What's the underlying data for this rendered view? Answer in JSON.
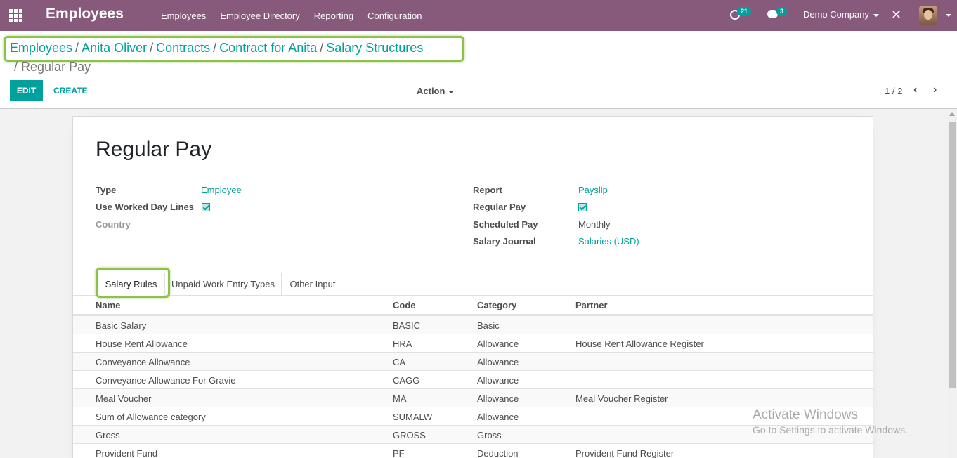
{
  "navbar": {
    "brand": "Employees",
    "menu": [
      "Employees",
      "Employee Directory",
      "Reporting",
      "Configuration"
    ],
    "activity_count": "21",
    "message_count": "3",
    "company": "Demo Company"
  },
  "breadcrumb": {
    "items": [
      "Employees",
      "Anita Oliver",
      "Contracts",
      "Contract for Anita",
      "Salary Structures"
    ],
    "current": "Regular Pay",
    "separator": "/"
  },
  "toolbar": {
    "edit_label": "EDIT",
    "create_label": "CREATE",
    "action_label": "Action",
    "pager": "1 / 2"
  },
  "form": {
    "title": "Regular Pay",
    "left": {
      "type_label": "Type",
      "type_value": "Employee",
      "worked_day_label": "Use Worked Day Lines",
      "worked_day_checked": true,
      "country_label": "Country"
    },
    "right": {
      "report_label": "Report",
      "report_value": "Payslip",
      "regular_pay_label": "Regular Pay",
      "regular_pay_checked": true,
      "scheduled_label": "Scheduled Pay",
      "scheduled_value": "Monthly",
      "journal_label": "Salary Journal",
      "journal_value": "Salaries (USD)"
    }
  },
  "tabs": [
    "Salary Rules",
    "Unpaid Work Entry Types",
    "Other Input"
  ],
  "table": {
    "headers": [
      "Name",
      "Code",
      "Category",
      "Partner"
    ],
    "rows": [
      [
        "Basic Salary",
        "BASIC",
        "Basic",
        ""
      ],
      [
        "House Rent Allowance",
        "HRA",
        "Allowance",
        "House Rent Allowance Register"
      ],
      [
        "Conveyance Allowance",
        "CA",
        "Allowance",
        ""
      ],
      [
        "Conveyance Allowance For Gravie",
        "CAGG",
        "Allowance",
        ""
      ],
      [
        "Meal Voucher",
        "MA",
        "Allowance",
        "Meal Voucher Register"
      ],
      [
        "Sum of Allowance category",
        "SUMALW",
        "Allowance",
        ""
      ],
      [
        "Gross",
        "GROSS",
        "Gross",
        ""
      ],
      [
        "Provident Fund",
        "PF",
        "Deduction",
        "Provident Fund Register"
      ]
    ]
  },
  "watermark": {
    "title": "Activate Windows",
    "subtitle": "Go to Settings to activate Windows."
  },
  "colors": {
    "navbar": "#875a7b",
    "accent": "#00a09d",
    "highlight": "#8bc34a"
  }
}
